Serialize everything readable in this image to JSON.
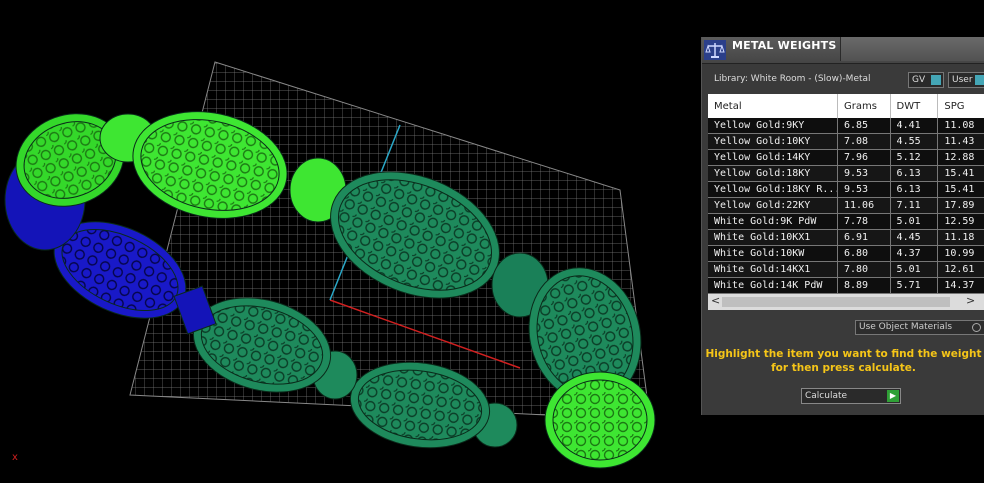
{
  "panel": {
    "title": "METAL WEIGHTS",
    "library_label": "Library: White Room - (Slow)-Metal",
    "gv_label": "GV",
    "user_label": "User",
    "columns": [
      "Metal",
      "Grams",
      "DWT",
      "SPG"
    ],
    "rows": [
      {
        "metal": "Yellow Gold:9KY",
        "grams": "6.85",
        "dwt": "4.41",
        "spg": "11.08"
      },
      {
        "metal": "Yellow Gold:10KY",
        "grams": "7.08",
        "dwt": "4.55",
        "spg": "11.43"
      },
      {
        "metal": "Yellow Gold:14KY",
        "grams": "7.96",
        "dwt": "5.12",
        "spg": "12.88"
      },
      {
        "metal": "Yellow Gold:18KY",
        "grams": "9.53",
        "dwt": "6.13",
        "spg": "15.41"
      },
      {
        "metal": "Yellow Gold:18KY R...",
        "grams": "9.53",
        "dwt": "6.13",
        "spg": "15.41"
      },
      {
        "metal": "Yellow Gold:22KY",
        "grams": "11.06",
        "dwt": "7.11",
        "spg": "17.89"
      },
      {
        "metal": "White Gold:9K PdW",
        "grams": "7.78",
        "dwt": "5.01",
        "spg": "12.59"
      },
      {
        "metal": "White Gold:10KX1",
        "grams": "6.91",
        "dwt": "4.45",
        "spg": "11.18"
      },
      {
        "metal": "White Gold:10KW",
        "grams": "6.80",
        "dwt": "4.37",
        "spg": "10.99"
      },
      {
        "metal": "White Gold:14KX1",
        "grams": "7.80",
        "dwt": "5.01",
        "spg": "12.61"
      },
      {
        "metal": "White Gold:14K PdW",
        "grams": "8.89",
        "dwt": "5.71",
        "spg": "14.37"
      }
    ],
    "scroll_left": "<",
    "scroll_right": ">",
    "use_object_materials": "Use Object Materials",
    "hint_line1": "Highlight the item you want to find the weight",
    "hint_line2": "for then press calculate.",
    "calculate_label": "Calculate",
    "calculate_arrow": "▶"
  },
  "viewport": {
    "axis_x_label": "x"
  },
  "colors": {
    "accent_yellow": "#f5c518",
    "teal": "#44a6b6",
    "ring_green_bright": "#3ee632",
    "ring_green_dark": "#1e8a5c",
    "ring_blue": "#1a1ae0",
    "grid_line": "#8a8a8a",
    "axis_red": "#d02020",
    "axis_cyan": "#2aa8c8"
  }
}
